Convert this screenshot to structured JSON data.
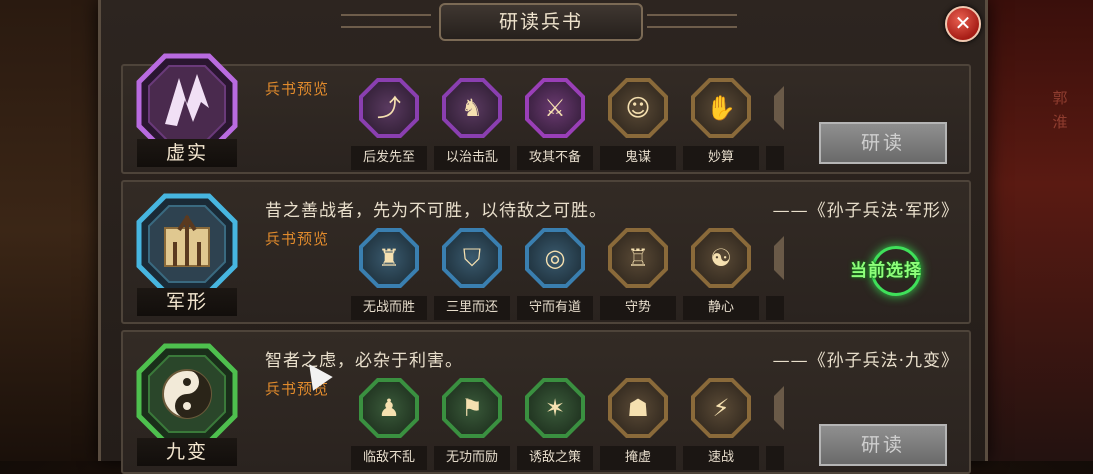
{
  "title": "研读兵书",
  "side_text": [
    "郭",
    "淮"
  ],
  "preview_label": "兵书预览",
  "study_label": "研读",
  "current_select_label": "当前选择",
  "books": [
    {
      "name": "虚实",
      "color": "#a24ccc",
      "skills": [
        {
          "label": "后发先至",
          "icon": "arrow-icon",
          "tint": "#8a3fb0"
        },
        {
          "label": "以治击乱",
          "icon": "rider-icon",
          "tint": "#8a3fb0"
        },
        {
          "label": "攻其不备",
          "icon": "warrior-icon",
          "tint": "#9a3fb8"
        },
        {
          "label": "鬼谋",
          "icon": "scholar-icon",
          "tint": "#8a6a3a"
        },
        {
          "label": "妙算",
          "icon": "scroll-icon",
          "tint": "#8a6a3a"
        }
      ]
    },
    {
      "name": "军形",
      "color": "#3aa0c8",
      "quote": "昔之善战者，先为不可胜，以待敌之可胜。",
      "source": "——《孙子兵法·军形》",
      "skills": [
        {
          "label": "无战而胜",
          "icon": "soldier-icon",
          "tint": "#3a7fb0"
        },
        {
          "label": "三里而还",
          "icon": "shield-icon",
          "tint": "#3a7fb0"
        },
        {
          "label": "守而有道",
          "icon": "ward-icon",
          "tint": "#3a7fb0"
        },
        {
          "label": "守势",
          "icon": "fortress-icon",
          "tint": "#8a6a3a"
        },
        {
          "label": "静心",
          "icon": "meditate-icon",
          "tint": "#8a6a3a"
        }
      ]
    },
    {
      "name": "九变",
      "color": "#3fb845",
      "quote": "智者之虑，必杂于利害。",
      "source": "——《孙子兵法·九变》",
      "skills": [
        {
          "label": "临敌不乱",
          "icon": "calm-warrior-icon",
          "tint": "#3a9040"
        },
        {
          "label": "无功而励",
          "icon": "banner-icon",
          "tint": "#3a9040"
        },
        {
          "label": "诱敌之策",
          "icon": "lure-icon",
          "tint": "#3a9040"
        },
        {
          "label": "掩虚",
          "icon": "cloak-icon",
          "tint": "#8a6a3a"
        },
        {
          "label": "速战",
          "icon": "charge-icon",
          "tint": "#8a6a3a"
        }
      ]
    }
  ]
}
